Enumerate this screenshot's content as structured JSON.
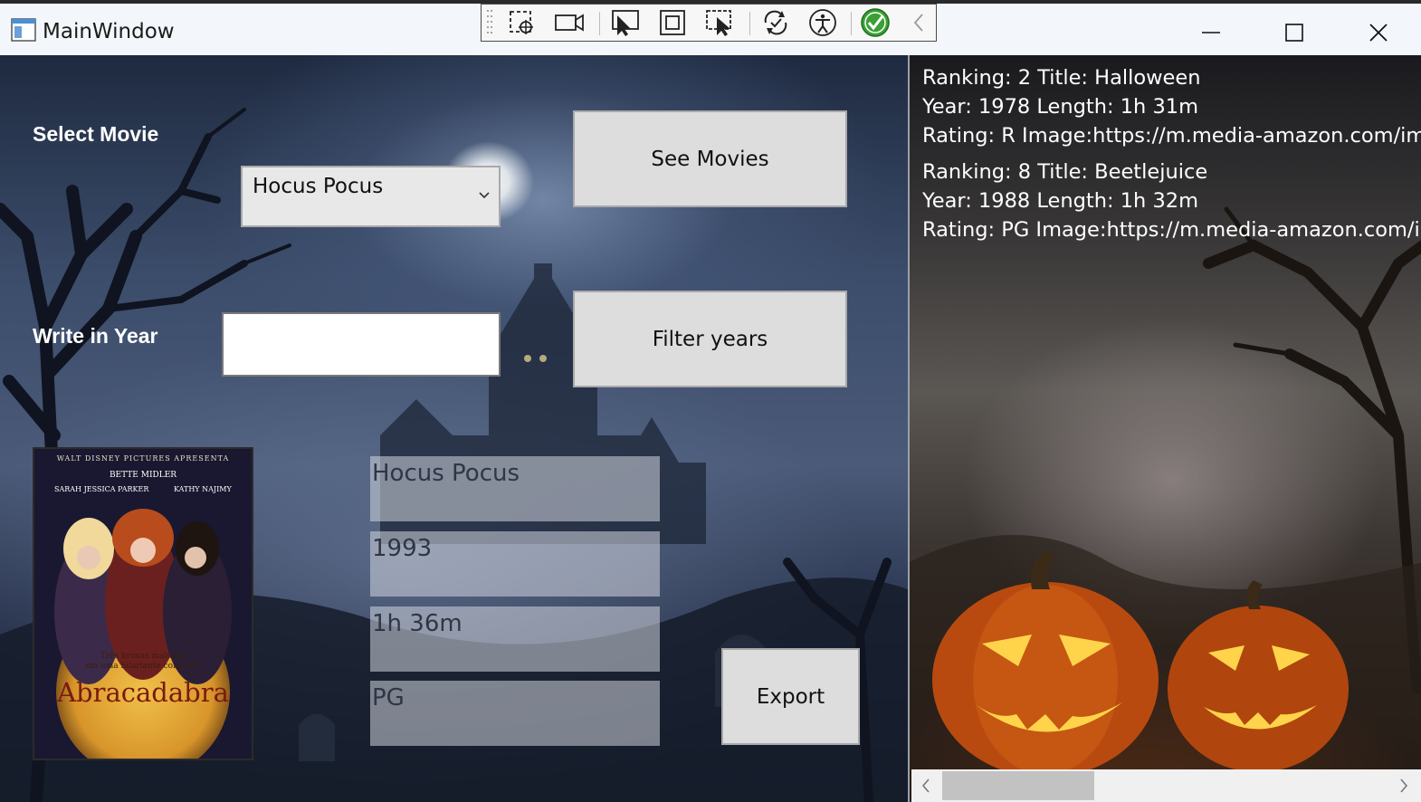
{
  "window": {
    "title": "MainWindow"
  },
  "form": {
    "select_movie_label": "Select Movie",
    "selected_movie": "Hocus Pocus",
    "see_movies_button": "See Movies",
    "write_year_label": "Write in Year",
    "year_input_value": "",
    "filter_years_button": "Filter years",
    "export_button": "Export"
  },
  "details": {
    "title": "Hocus Pocus",
    "year": "1993",
    "length": "1h 36m",
    "rating": "PG"
  },
  "poster": {
    "header": "WALT DISNEY PICTURES APRESENTA",
    "actor1": "BETTE MIDLER",
    "actor2": "SARAH JESSICA PARKER",
    "actor3": "KATHY NAJIMY",
    "tagline1": "Três bruxas malucas",
    "tagline2": "em uma hilariante comédia.",
    "title": "Abracadabra"
  },
  "movie_list": [
    {
      "line1": "Ranking: 2 Title: Halloween",
      "line2": "Year: 1978 Length: 1h 31m",
      "line3": "Rating: R Image:https://m.media-amazon.com/image"
    },
    {
      "line1": "Ranking: 8 Title: Beetlejuice",
      "line2": "Year: 1988 Length: 1h 32m",
      "line3": "Rating: PG Image:https://m.media-amazon.com/ima"
    }
  ],
  "icons": {
    "app": "window-app-icon",
    "minimize": "minimize-icon",
    "maximize": "maximize-icon",
    "close": "close-icon",
    "toolbar": [
      "drag-grip-icon",
      "select-element-icon",
      "video-icon",
      "pointer-select-icon",
      "display-layout-icon",
      "track-focus-icon",
      "hot-reload-icon",
      "accessibility-icon",
      "checkmark-icon",
      "collapse-chevron-icon"
    ]
  },
  "colors": {
    "titlebar": "#f3f6fb",
    "button_bg": "#dddddd",
    "label_text": "#ffffff",
    "check_green": "#3aa035"
  }
}
